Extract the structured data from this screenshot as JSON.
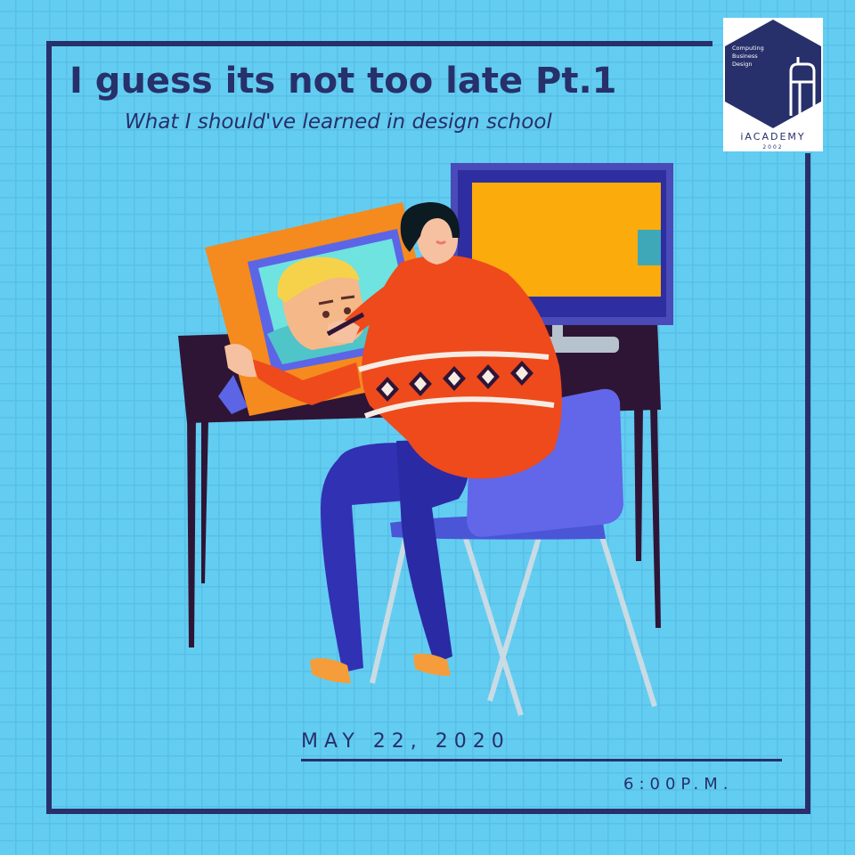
{
  "poster": {
    "title": "I guess its not too late Pt.1",
    "subtitle": "What I should've learned in design school",
    "date": "MAY 22, 2020",
    "time": "6:00P.M."
  },
  "logo": {
    "line1": "Computing",
    "line2": "Business",
    "line3": "Design",
    "brand": "iACADEMY",
    "year": "2002"
  },
  "colors": {
    "background": "#63cdf1",
    "grid": "#58bfe6",
    "navy": "#27306a",
    "sweater": "#ee4a1c",
    "chair": "#6167e8",
    "pants": "#3131b4",
    "monitor_screen": "#fbab0c",
    "tablet": "#f58a1f",
    "desk": "#2e1536"
  },
  "icons": [
    "hexagon-logo-icon",
    "designer-illustration"
  ]
}
